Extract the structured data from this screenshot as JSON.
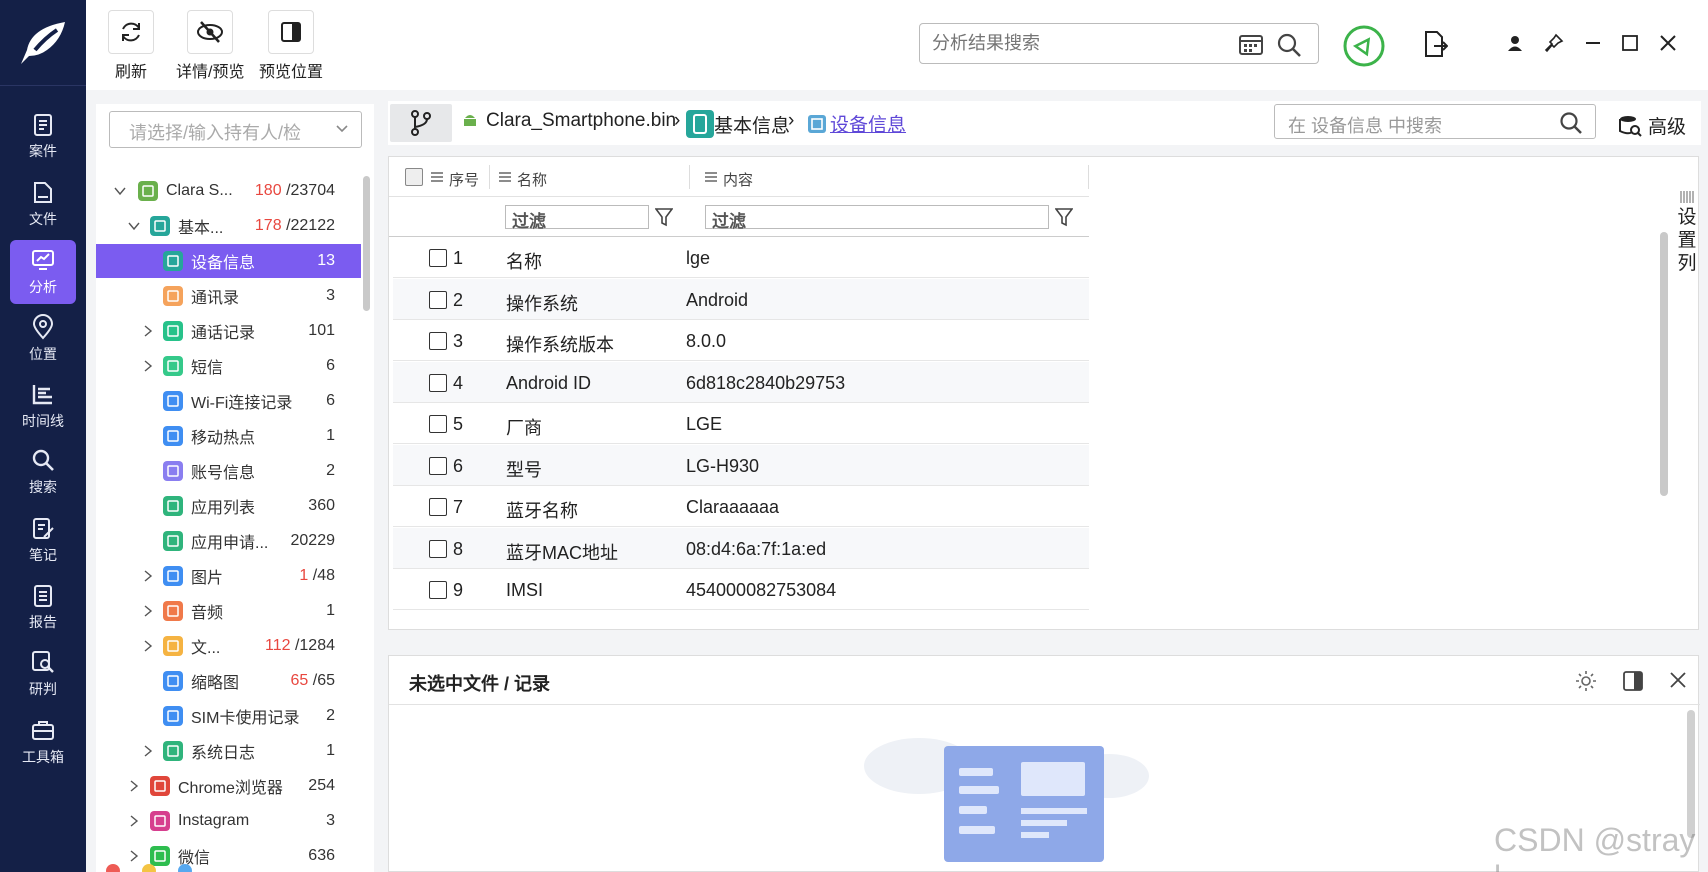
{
  "toolbar": {
    "refresh_label": "刷新",
    "detail_preview_label": "详情/预览",
    "preview_position_label": "预览位置"
  },
  "global_search": {
    "placeholder": "分析结果搜索"
  },
  "nav": {
    "items": [
      {
        "label": "案件",
        "icon": "clipboard-icon"
      },
      {
        "label": "文件",
        "icon": "file-icon"
      },
      {
        "label": "分析",
        "icon": "monitor-icon",
        "active": true
      },
      {
        "label": "位置",
        "icon": "location-pin-icon"
      },
      {
        "label": "时间线",
        "icon": "timeline-icon"
      },
      {
        "label": "搜索",
        "icon": "search-icon"
      },
      {
        "label": "笔记",
        "icon": "note-edit-icon"
      },
      {
        "label": "报告",
        "icon": "report-icon"
      },
      {
        "label": "研判",
        "icon": "analysis-search-icon"
      },
      {
        "label": "工具箱",
        "icon": "toolbox-icon"
      }
    ]
  },
  "owner_select": {
    "placeholder": "请选择/输入持有人/检"
  },
  "tree": [
    {
      "label": "Clara S...",
      "count_red": "180",
      "count": "/23704",
      "icon": "android-icon",
      "expanded": true
    },
    {
      "label": "基本...",
      "count_red": "178",
      "count": "/22122",
      "icon": "device-info-icon",
      "expanded": true
    },
    {
      "label": "设备信息",
      "count": "13",
      "icon": "device-info-icon",
      "selected": true
    },
    {
      "label": "通讯录",
      "count": "3",
      "icon": "contacts-icon"
    },
    {
      "label": "通话记录",
      "count": "101",
      "icon": "phone-icon"
    },
    {
      "label": "短信",
      "count": "6",
      "icon": "sms-icon"
    },
    {
      "label": "Wi-Fi连接记录",
      "count": "6",
      "icon": "wifi-icon"
    },
    {
      "label": "移动热点",
      "count": "1",
      "icon": "hotspot-icon"
    },
    {
      "label": "账号信息",
      "count": "2",
      "icon": "account-icon"
    },
    {
      "label": "应用列表",
      "count": "360",
      "icon": "app-list-icon"
    },
    {
      "label": "应用申请...",
      "count": "20229",
      "icon": "app-list-icon"
    },
    {
      "label": "图片",
      "count_red": "1",
      "count": "/48",
      "icon": "image-icon"
    },
    {
      "label": "音频",
      "count": "1",
      "icon": "audio-icon"
    },
    {
      "label": "文...",
      "count_red": "112",
      "count": "/1284",
      "icon": "document-icon"
    },
    {
      "label": "缩略图",
      "count_red": "65",
      "count": "/65",
      "icon": "image-icon"
    },
    {
      "label": "SIM卡使用记录",
      "count": "2",
      "icon": "sim-icon"
    },
    {
      "label": "系统日志",
      "count": "1",
      "icon": "log-icon"
    },
    {
      "label": "Chrome浏览器",
      "count": "254",
      "icon": "chrome-icon"
    },
    {
      "label": "Instagram",
      "count": "3",
      "icon": "instagram-icon"
    },
    {
      "label": "微信",
      "count": "636",
      "icon": "wechat-icon"
    }
  ],
  "breadcrumb": {
    "file": "Clara_Smartphone.bin",
    "category": "基本信息",
    "current": "设备信息"
  },
  "detail_search": {
    "placeholder": "在 设备信息 中搜索"
  },
  "advanced_label": "高级",
  "table": {
    "columns": [
      "序号",
      "名称",
      "内容"
    ],
    "filter_placeholder": "过滤",
    "rows": [
      {
        "no": "1",
        "name": "名称",
        "value": "lge"
      },
      {
        "no": "2",
        "name": "操作系统",
        "value": "Android"
      },
      {
        "no": "3",
        "name": "操作系统版本",
        "value": "8.0.0"
      },
      {
        "no": "4",
        "name": "Android ID",
        "value": "6d818c2840b29753"
      },
      {
        "no": "5",
        "name": "厂商",
        "value": "LGE"
      },
      {
        "no": "6",
        "name": "型号",
        "value": "LG-H930"
      },
      {
        "no": "7",
        "name": "蓝牙名称",
        "value": "Claraaaaaa"
      },
      {
        "no": "8",
        "name": "蓝牙MAC地址",
        "value": "08:d4:6a:7f:1a:ed"
      },
      {
        "no": "9",
        "name": "IMSI",
        "value": "454000082753084"
      }
    ]
  },
  "column_settings_label": "设置列",
  "detail_panel": {
    "title": "未选中文件 / 记录"
  },
  "watermark": "CSDN @stray l",
  "colors": {
    "nav_bg": "#142047",
    "accent": "#7b5cf0",
    "count_red": "#e8473f"
  }
}
